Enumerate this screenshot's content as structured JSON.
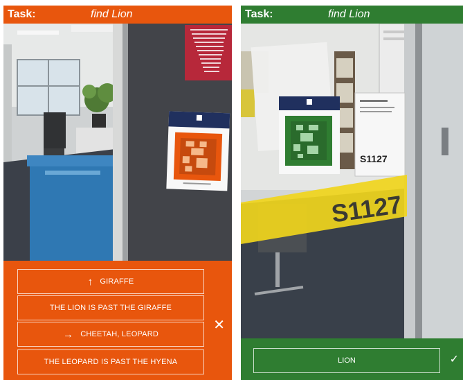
{
  "colors": {
    "orange": "#e8560d",
    "green": "#2f7d31"
  },
  "left_panel": {
    "task_label": "Task:",
    "target": "find Lion",
    "options": [
      {
        "icon": "arrow-up-icon",
        "glyph": "↑",
        "label": "GIRAFFE"
      },
      {
        "icon": "",
        "glyph": "",
        "label": "THE LION IS PAST THE GIRAFFE"
      },
      {
        "icon": "arrow-right-icon",
        "glyph": "→",
        "label": "CHEETAH, LEOPARD"
      },
      {
        "icon": "",
        "glyph": "",
        "label": "THE LEOPARD IS PAST THE HYENA"
      }
    ],
    "close_glyph": "✕"
  },
  "right_panel": {
    "task_label": "Task:",
    "target": "find Lion",
    "room_number": "S1127",
    "sign_number": "S1127",
    "confirm_label": "LION",
    "check_glyph": "✓"
  }
}
